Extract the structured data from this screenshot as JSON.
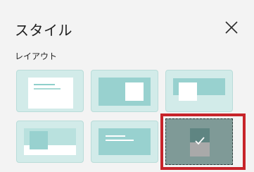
{
  "dialog": {
    "title": "スタイル",
    "close_icon": "close-icon"
  },
  "layout_section": {
    "label": "レイアウト",
    "options": [
      {
        "id": "title-text-top",
        "selected": false
      },
      {
        "id": "image-right",
        "selected": false
      },
      {
        "id": "image-left-band",
        "selected": false
      },
      {
        "id": "image-left-bottom",
        "selected": false
      },
      {
        "id": "text-lines-center",
        "selected": false
      },
      {
        "id": "image-center",
        "selected": true
      }
    ]
  },
  "colors": {
    "tile_bg": "#d2ebe9",
    "tile_accent": "#98d1cf",
    "selection_border": "#c7242a",
    "selected_tile_bg": "#7f9a97"
  }
}
